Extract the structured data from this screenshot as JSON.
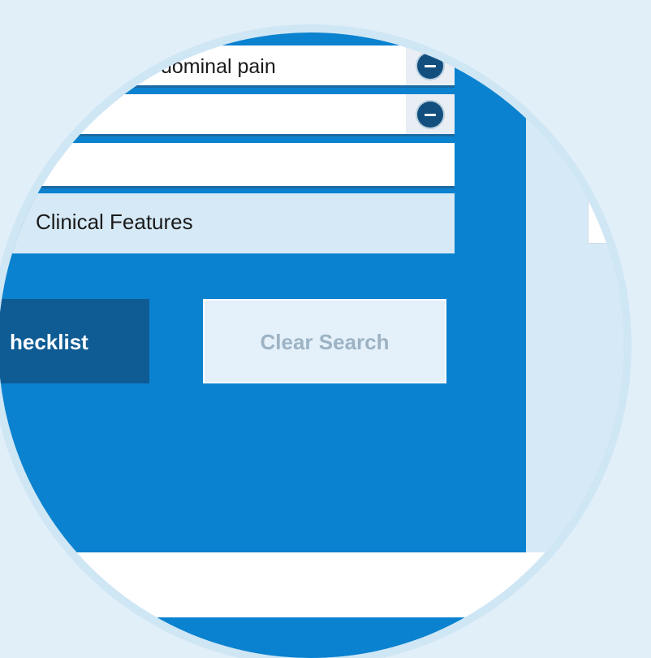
{
  "fields": [
    {
      "text": "dominal pain",
      "remove_icon": "minus-circle-icon"
    },
    {
      "text": "",
      "remove_icon": "minus-circle-icon"
    },
    {
      "text": ""
    }
  ],
  "features_label": "Clinical Features",
  "buttons": {
    "checklist_label": "hecklist",
    "clear_label": "Clear Search"
  },
  "colors": {
    "panel_blue": "#0a82cf",
    "dark_button": "#0f5c94",
    "remove_icon": "#124f7e",
    "features_bg": "#d6e9f6"
  }
}
